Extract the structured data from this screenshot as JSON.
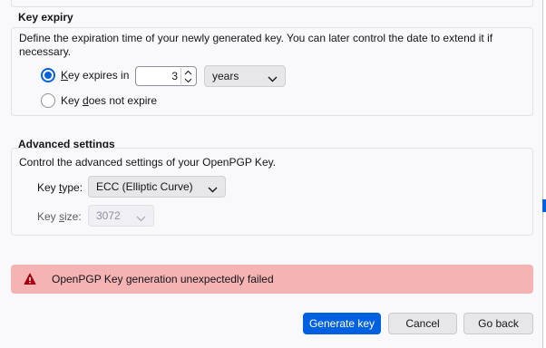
{
  "key_expiry": {
    "legend": "Key expiry",
    "description": "Define the expiration time of your newly generated key. You can later control the date to extend it if necessary.",
    "expires_label_prefix": "K",
    "expires_label_rest": "ey expires in",
    "expires_value": "3",
    "unit_options_selected": "years",
    "no_expire_prefix": "Key ",
    "no_expire_access": "d",
    "no_expire_rest": "oes not expire"
  },
  "advanced": {
    "legend": "Advanced settings",
    "description": "Control the advanced settings of your OpenPGP Key.",
    "key_type_label_prefix": "Key ",
    "key_type_label_access": "t",
    "key_type_label_rest": "ype:",
    "key_type_value": "ECC (Elliptic Curve)",
    "key_size_label_prefix": "Key ",
    "key_size_label_access": "s",
    "key_size_label_rest": "ize:",
    "key_size_value": "3072"
  },
  "error": {
    "message": "OpenPGP Key generation unexpectedly failed",
    "color": "#f5b3b3"
  },
  "buttons": {
    "generate": "Generate key",
    "cancel": "Cancel",
    "back": "Go back"
  },
  "colors": {
    "accent": "#0061e0",
    "error_bg": "#f5b3b3",
    "error_icon": "#a4000f"
  }
}
